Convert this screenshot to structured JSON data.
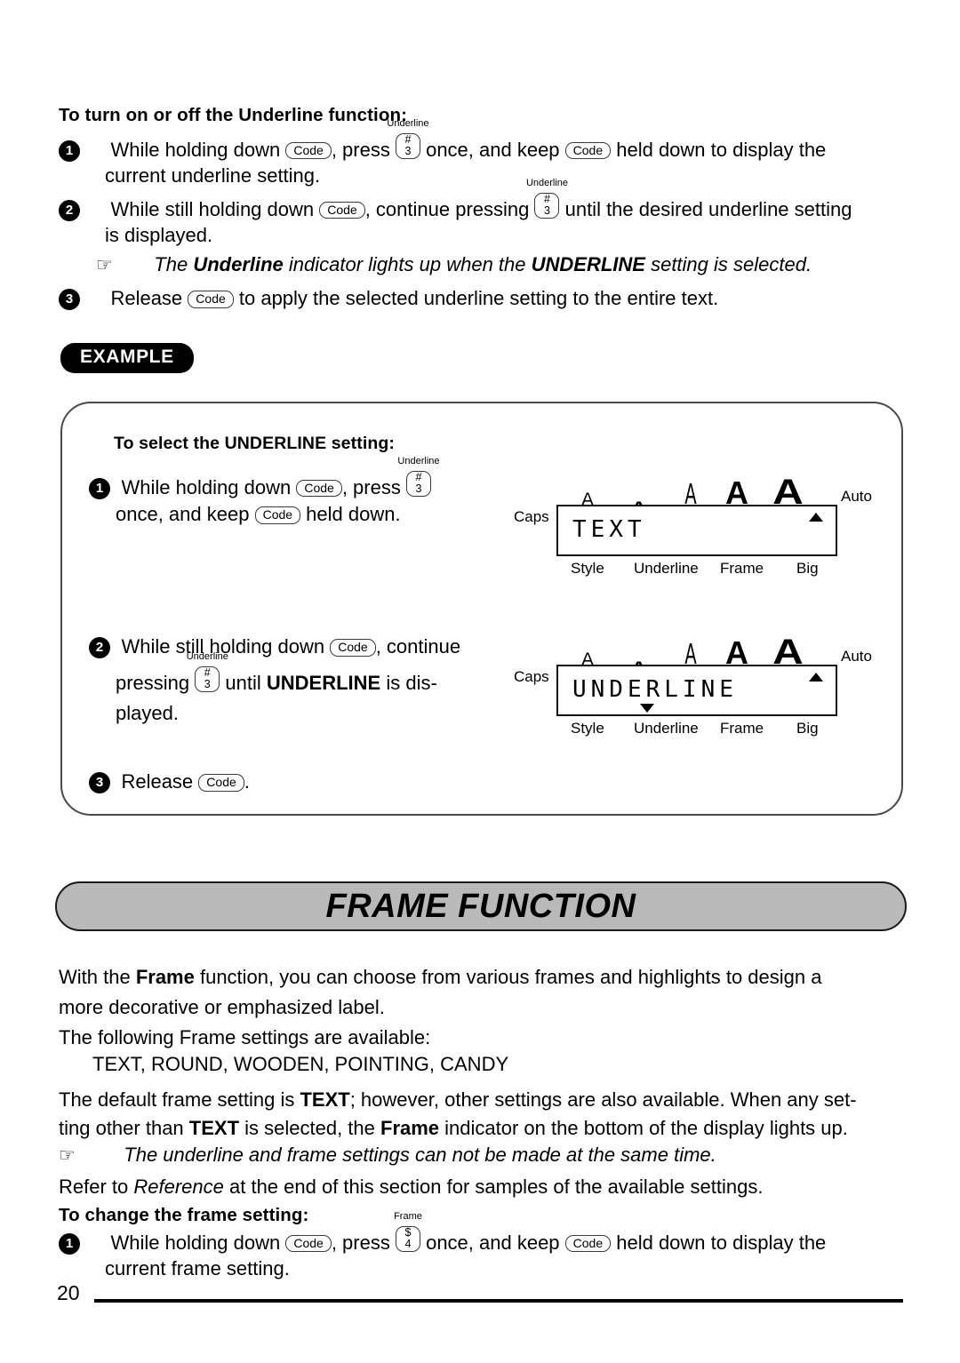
{
  "page": {
    "number": "20"
  },
  "underline_section": {
    "heading": "To turn on or off the Underline function:",
    "steps": [
      {
        "num": "1",
        "parts": {
          "t1": "While holding down ",
          "key1": "Code",
          "t2": ", press ",
          "key2_label": "Underline",
          "key2_top": "#",
          "key2_bot": "3",
          "t3": " once, and keep ",
          "key3": "Code",
          "t4": " held down to display the",
          "line2": "current underline setting."
        }
      },
      {
        "num": "2",
        "parts": {
          "t1": "While still holding down ",
          "key1": "Code",
          "t2": ", continue pressing ",
          "key2_label": "Underline",
          "key2_top": "#",
          "key2_bot": "3",
          "t3": " until the desired underline setting",
          "line2": "is displayed."
        }
      },
      {
        "num": "3",
        "parts": {
          "t1": "Release ",
          "key1": "Code",
          "t2": " to apply the selected underline setting to the entire text."
        }
      }
    ],
    "note": {
      "icon": "hand-pointing-icon",
      "glyph": "☞",
      "pre": "The ",
      "bold1": "Underline",
      "mid": " indicator lights up when the ",
      "bold2": "UNDERLINE",
      "post": " setting is selected."
    }
  },
  "example": {
    "pill_label": "EXAMPLE",
    "heading": "To select the UNDERLINE setting:",
    "steps": [
      {
        "num": "1",
        "t1": "While  holding  down ",
        "key1": "Code",
        "t2": ",  press ",
        "key2_label": "Underline",
        "key2_top": "#",
        "key2_bot": "3",
        "line2_a": "once, and keep ",
        "key3": "Code",
        "line2_b": " held down."
      },
      {
        "num": "2",
        "t1": "While  still  holding  down ",
        "key1": "Code",
        "t2": ",  continue",
        "line2_a": "pressing ",
        "key2_label": "Underline",
        "key2_top": "#",
        "key2_bot": "3",
        "line2_b": "  until ",
        "line2_bold": "UNDERLINE",
        "line2_c": " is  dis-",
        "line3": "played."
      },
      {
        "num": "3",
        "t1": "Release ",
        "key1": "Code",
        "t2": "."
      }
    ],
    "displays": [
      {
        "caps": "Caps",
        "auto": "Auto",
        "text": "TEXT",
        "footer": [
          "Style",
          "Underline",
          "Frame",
          "Big"
        ],
        "size_marks": [
          "A",
          "A",
          "A",
          "A",
          "A"
        ],
        "indicator_up": true,
        "indicator_underline_down": false
      },
      {
        "caps": "Caps",
        "auto": "Auto",
        "text": "UNDERLINE",
        "footer": [
          "Style",
          "Underline",
          "Frame",
          "Big"
        ],
        "size_marks": [
          "A",
          "A",
          "A",
          "A",
          "A"
        ],
        "indicator_up": true,
        "indicator_underline_down": true
      }
    ]
  },
  "frame_section": {
    "banner_title": "FRAME FUNCTION",
    "banner_color": "#b9b9b9",
    "p1_a": "With the ",
    "p1_bold": "Frame",
    "p1_b": " function, you can choose from various frames and highlights to design a",
    "p1_line2": "more decorative or emphasized label.",
    "p2": "The following Frame settings are available:",
    "settings_list": "TEXT, ROUND, WOODEN, POINTING, CANDY",
    "p3_a": "The default frame setting is ",
    "p3_bold1": "TEXT",
    "p3_b": "; however, other settings are also available. When any set-",
    "p3_line2_a": "ting other than ",
    "p3_bold2": "TEXT",
    "p3_line2_b": " is selected, the ",
    "p3_bold3": "Frame",
    "p3_line2_c": " indicator on the bottom of the display lights up.",
    "note": {
      "glyph": "☞",
      "text": "The underline and frame settings can not be made at the same time."
    },
    "p4_a": "Refer to ",
    "p4_italic": "Reference",
    "p4_b": " at the end of this section for samples of the available settings.",
    "sub_heading": "To change the frame setting:",
    "step": {
      "num": "1",
      "t1": "While holding down ",
      "key1": "Code",
      "t2": ", press ",
      "key2_label": "Frame",
      "key2_top": "$",
      "key2_bot": "4",
      "t3": " once, and keep ",
      "key3": "Code",
      "t4": " held down to display the",
      "line2": "current frame setting."
    }
  }
}
